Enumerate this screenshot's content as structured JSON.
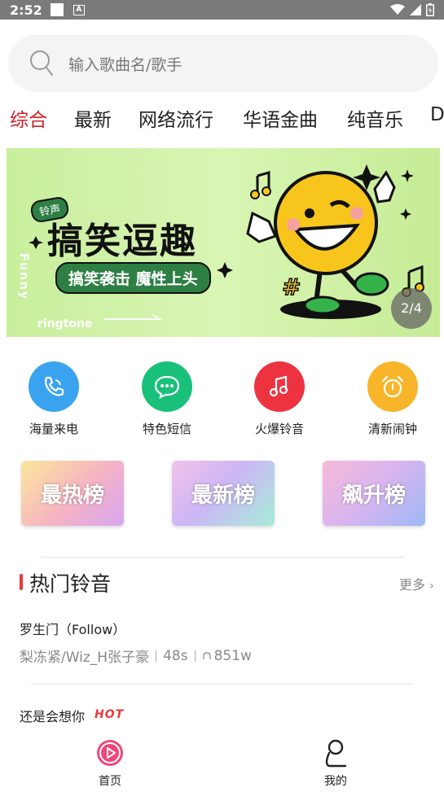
{
  "status_bar": {
    "time": "2:52"
  },
  "search": {
    "placeholder": "输入歌曲名/歌手"
  },
  "tabs": [
    {
      "label": "综合",
      "active": true
    },
    {
      "label": "最新",
      "active": false
    },
    {
      "label": "网络流行",
      "active": false
    },
    {
      "label": "华语金曲",
      "active": false
    },
    {
      "label": "纯音乐",
      "active": false
    },
    {
      "label": "D",
      "active": false
    }
  ],
  "banner": {
    "title": "搞笑逗趣",
    "subtitle": "搞笑袭击 魔性上头",
    "tag": "铃声",
    "side_text": "Funny",
    "bottom_text": "ringtone",
    "indicator": "2/4"
  },
  "quick_actions": [
    {
      "label": "海量来电",
      "icon": "phone-icon",
      "color": "#3aa3f0"
    },
    {
      "label": "特色短信",
      "icon": "message-icon",
      "color": "#19c07a"
    },
    {
      "label": "火爆铃音",
      "icon": "music-note-icon",
      "color": "#ee3340"
    },
    {
      "label": "清新闹钟",
      "icon": "alarm-clock-icon",
      "color": "#f8b52a"
    }
  ],
  "rank_cards": [
    {
      "label": "最热榜"
    },
    {
      "label": "最新榜"
    },
    {
      "label": "飙升榜"
    }
  ],
  "hot_section": {
    "title": "热门铃音",
    "more": "更多",
    "songs": [
      {
        "title": "罗生门（Follow）",
        "artist": "梨冻紧/Wiz_H张子豪",
        "duration": "48s",
        "plays": "851w"
      },
      {
        "title": "还是会想你",
        "badge": "HOT"
      }
    ]
  },
  "bottom_nav": [
    {
      "label": "首页",
      "icon": "home-play-icon",
      "active": true
    },
    {
      "label": "我的",
      "icon": "user-icon",
      "active": false
    }
  ],
  "colors": {
    "accent": "#d0202a",
    "banner_bg": "#c8ef9e",
    "hot_red": "#e8383d"
  }
}
